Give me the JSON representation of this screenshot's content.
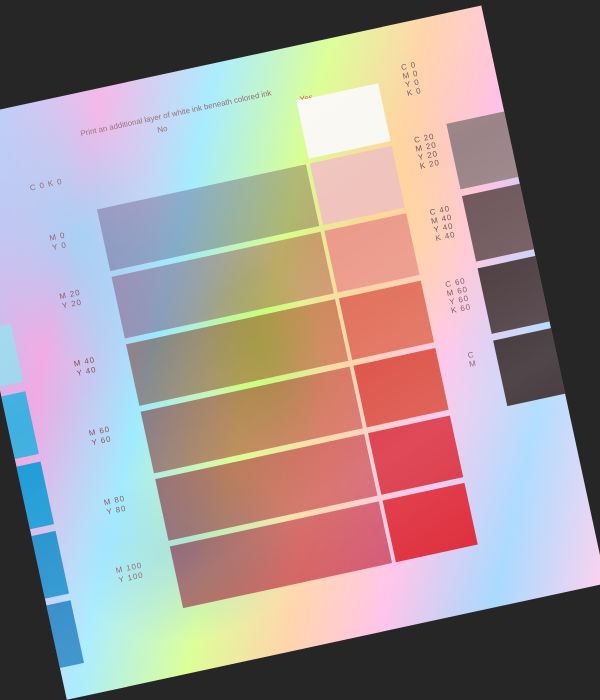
{
  "header": {
    "main": "Print an additional layer of white ink beneath colored ink",
    "no": "No",
    "yes": "Yes"
  },
  "rows": [
    {
      "cmy": [
        "C 0  K 0"
      ],
      "color_no": null,
      "color_yes": "#f9f8f2",
      "y_offset": 0
    },
    {
      "cmy": [
        "M 0",
        "Y 0"
      ],
      "color_no": "#b89bb1",
      "color_yes": "#f0c3bc"
    },
    {
      "cmy": [
        "M 20",
        "Y 20"
      ],
      "color_no": "#d38aa2",
      "color_yes": "#ec9a8a"
    },
    {
      "cmy": [
        "M 40",
        "Y 40"
      ],
      "color_no": "#c96d62",
      "color_yes": "#e06a55"
    },
    {
      "cmy": [
        "M 60",
        "Y 60"
      ],
      "color_no": "#c55257",
      "color_yes": "#d94438"
    },
    {
      "cmy": [
        "M 80",
        "Y 80"
      ],
      "color_no": "#c0344a",
      "color_yes": "#d82334"
    },
    {
      "cmy": [
        "M 100",
        "Y 100"
      ],
      "color_no": "#be2245",
      "color_yes": "#dc1e2e"
    }
  ],
  "side_column": [
    {
      "lines": [
        "C 0",
        "M 0",
        "Y 0",
        "K 0"
      ],
      "color": null
    },
    {
      "lines": [
        "C 20",
        "M 20",
        "Y 20",
        "K 20"
      ],
      "color": "#9a8488"
    },
    {
      "lines": [
        "C 40",
        "M 40",
        "Y 40",
        "K 40"
      ],
      "color": "#6b5257"
    },
    {
      "lines": [
        "C 60",
        "M 60",
        "Y 60",
        "K 60"
      ],
      "color": "#3f2e33"
    },
    {
      "lines": [
        "C",
        "M"
      ],
      "color": "#2a1d21"
    }
  ],
  "left_column_colors": [
    "#9ed6ee",
    "#3fb0e0",
    "#1b9ad6",
    "#1a8ccc",
    "#1a7fc2"
  ]
}
